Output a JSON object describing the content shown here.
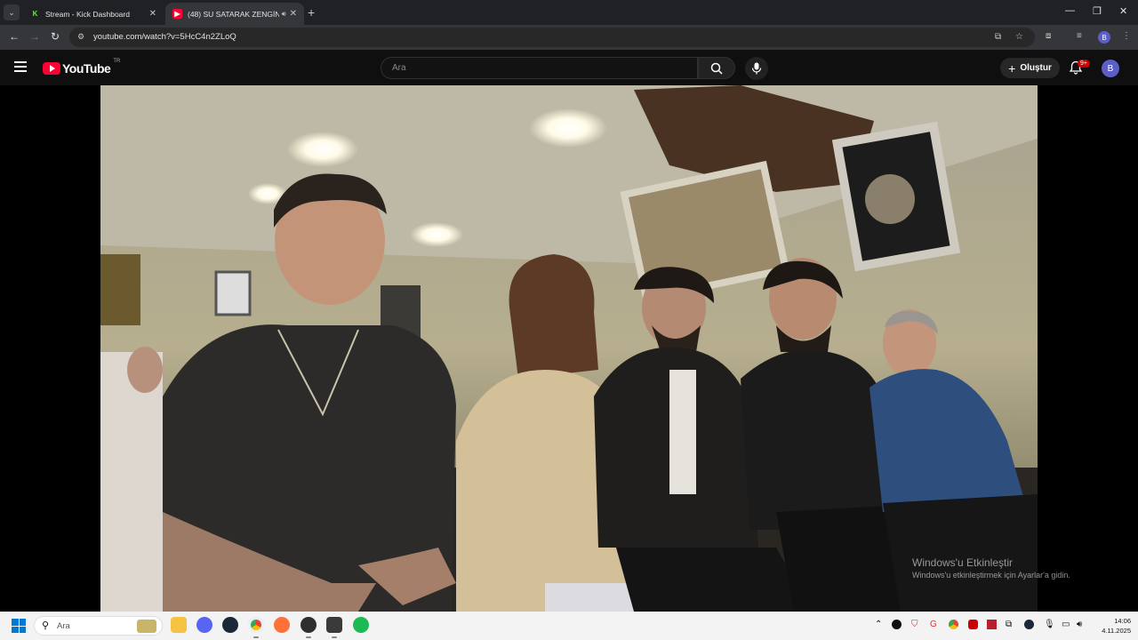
{
  "browser": {
    "tabs": [
      {
        "title": "Stream - Kick Dashboard",
        "favicon": "kick-icon"
      },
      {
        "title": "(48) SU SATARAK ZENGİN O",
        "favicon": "youtube-icon",
        "audio": true
      }
    ],
    "url": "youtube.com/watch?v=5HcC4n2ZLoQ",
    "profile_initial": "B"
  },
  "youtube": {
    "logo_text": "YouTube",
    "country_code": "TR",
    "search_placeholder": "Ara",
    "create_label": "Oluştur",
    "notification_count": "9+",
    "avatar_initial": "B"
  },
  "windows_activation": {
    "title": "Windows'u Etkinleştir",
    "subtitle": "Windows'u etkinleştirmek için Ayarlar'a gidin."
  },
  "taskbar": {
    "search_label": "Ara",
    "time": "14:06",
    "date": "4.11.2025",
    "apps": [
      "file-explorer-icon",
      "discord-icon",
      "steam-icon",
      "chrome-icon",
      "firefox-icon",
      "obs-icon",
      "app-icon",
      "spotify-icon"
    ]
  },
  "colors": {
    "youtube_red": "#ff0033",
    "accent": "#5b5fc7",
    "kick_green": "#53fc18"
  }
}
